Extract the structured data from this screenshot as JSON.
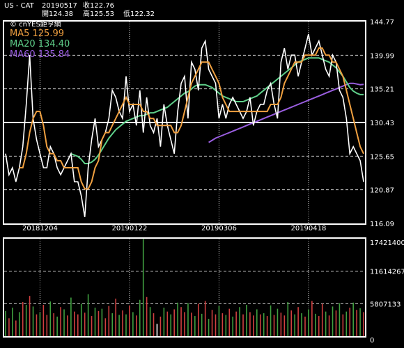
{
  "header": {
    "symbol": "US - CAT",
    "date": "20190517",
    "close_label": "收122.76",
    "open_label": "開124.38",
    "high_label": "高125.53",
    "low_label": "低122.32"
  },
  "legend": {
    "copyright": "© cnYES鉅亨網",
    "ma5": "MA5 125.99",
    "ma20": "MA20 134.40",
    "ma60": "MA60 135.84"
  },
  "colors": {
    "background": "#000000",
    "price": "#ffffff",
    "ma5": "#f0a040",
    "ma20": "#5fd08a",
    "ma60": "#9a5ee0",
    "vol_up": "#d04040",
    "vol_down": "#40a040",
    "grid": "#ffffff"
  },
  "chart_data": [
    {
      "type": "line",
      "title": "",
      "x_ticks": [
        "20181204",
        "20190122",
        "20190306",
        "20190418"
      ],
      "y_ticks": [
        "144.77",
        "139.99",
        "135.21",
        "130.43",
        "125.65",
        "120.87",
        "116.09"
      ],
      "ylim": [
        116.09,
        144.77
      ],
      "series": [
        {
          "name": "MA5",
          "key": "ma5"
        },
        {
          "name": "MA20",
          "key": "ma20"
        },
        {
          "name": "MA60",
          "key": "ma60"
        }
      ],
      "close": [
        126,
        123,
        124,
        122,
        124,
        127,
        133,
        140,
        131,
        128,
        126,
        124,
        124,
        127,
        126,
        124,
        123,
        124,
        125,
        126,
        122,
        122,
        120,
        117,
        124,
        128,
        131,
        127,
        128,
        129,
        131,
        135,
        134,
        132,
        131,
        137,
        132,
        133,
        130,
        135,
        129,
        134,
        130,
        129,
        131,
        127,
        133,
        130,
        128,
        126,
        132,
        136,
        137,
        131,
        139,
        138,
        135,
        141,
        142,
        138,
        137,
        136,
        131,
        133,
        131,
        133,
        134,
        133,
        132,
        131,
        132,
        134,
        130,
        132,
        133,
        133,
        135,
        136,
        133,
        131,
        139,
        141,
        138,
        140,
        140,
        137,
        139,
        141,
        143,
        140,
        141,
        142,
        140,
        138,
        137,
        140,
        139,
        135,
        134,
        131,
        126,
        127,
        126,
        125,
        122
      ],
      "ma5": [
        null,
        null,
        null,
        null,
        124,
        124,
        126,
        129,
        131,
        132,
        132,
        130,
        127,
        126,
        126,
        125,
        125,
        124,
        124,
        124,
        124,
        124,
        122,
        121,
        121,
        122,
        124,
        125,
        128,
        129,
        129,
        130,
        131,
        132,
        133,
        134,
        133,
        133,
        133,
        133,
        132,
        132,
        131,
        131,
        130,
        130,
        130,
        130,
        130,
        129,
        129,
        130,
        132,
        134,
        136,
        137,
        138,
        139,
        139,
        139,
        138,
        137,
        136,
        134,
        133,
        132,
        132,
        132,
        132,
        132,
        132,
        132,
        132,
        132,
        132,
        132,
        132,
        133,
        133,
        133,
        134,
        136,
        137,
        138,
        139,
        139,
        139,
        140,
        140,
        140,
        140,
        141,
        141,
        140,
        140,
        139,
        139,
        138,
        137,
        135,
        133,
        131,
        129,
        127,
        126
      ],
      "ma20": [
        null,
        null,
        null,
        null,
        null,
        null,
        null,
        null,
        null,
        null,
        null,
        null,
        null,
        null,
        null,
        null,
        null,
        null,
        null,
        126,
        125.8,
        125.6,
        125.2,
        124.6,
        124.6,
        124.8,
        125.2,
        125.8,
        126.6,
        127.4,
        128.2,
        128.8,
        129.4,
        129.8,
        130.2,
        130.6,
        130.8,
        131,
        131.2,
        131.4,
        131.4,
        131.6,
        131.8,
        131.8,
        132,
        132.2,
        132.4,
        132.6,
        133,
        133.4,
        133.8,
        134.2,
        134.6,
        134.8,
        135.2,
        135.6,
        135.8,
        135.8,
        135.8,
        135.6,
        135.4,
        135,
        134.6,
        134.2,
        134,
        133.8,
        133.6,
        133.4,
        133.4,
        133.4,
        133.6,
        133.8,
        134,
        134.2,
        134.6,
        135,
        135.4,
        135.8,
        136.2,
        136.6,
        137,
        137.4,
        137.8,
        138.2,
        138.6,
        139,
        139.2,
        139.4,
        139.6,
        139.6,
        139.6,
        139.6,
        139.4,
        139.2,
        139,
        138.6,
        138.2,
        137.6,
        137,
        136.2,
        135.4,
        134.9,
        134.6,
        134.4,
        134.4
      ],
      "ma60": [
        null,
        null,
        null,
        null,
        null,
        null,
        null,
        null,
        null,
        null,
        null,
        null,
        null,
        null,
        null,
        null,
        null,
        null,
        null,
        null,
        null,
        null,
        null,
        null,
        null,
        null,
        null,
        null,
        null,
        null,
        null,
        null,
        null,
        null,
        null,
        null,
        null,
        null,
        null,
        null,
        null,
        null,
        null,
        null,
        null,
        null,
        null,
        null,
        null,
        null,
        null,
        null,
        null,
        null,
        null,
        null,
        null,
        null,
        null,
        127.6,
        127.9,
        128.2,
        128.4,
        128.6,
        128.8,
        129,
        129.2,
        129.4,
        129.6,
        129.8,
        130,
        130.2,
        130.4,
        130.6,
        130.8,
        131,
        131.2,
        131.4,
        131.6,
        131.8,
        132,
        132.2,
        132.4,
        132.6,
        132.8,
        133,
        133.2,
        133.4,
        133.6,
        133.8,
        134,
        134.2,
        134.4,
        134.6,
        134.8,
        135,
        135.2,
        135.4,
        135.6,
        135.8,
        136,
        136,
        135.9,
        135.8,
        135.84
      ]
    },
    {
      "type": "bar",
      "title": "",
      "y_ticks": [
        "17421400",
        "11614267",
        "5807133",
        "0"
      ],
      "ylim": [
        0,
        17421400
      ],
      "volume": [
        4500000,
        3200000,
        5100000,
        2800000,
        4300000,
        6100000,
        5600000,
        7200000,
        5300000,
        3900000,
        4200000,
        5600000,
        3800000,
        6200000,
        4100000,
        3500000,
        5200000,
        4800000,
        3700000,
        6900000,
        4400000,
        3900000,
        5800000,
        4200000,
        7500000,
        3600000,
        5100000,
        4500000,
        4900000,
        3200000,
        5400000,
        4100000,
        6700000,
        3800000,
        4600000,
        3900000,
        5500000,
        4300000,
        3700000,
        6500000,
        17400000,
        7000000,
        5200000,
        4100000,
        2200000,
        3500000,
        5100000,
        4400000,
        3900000,
        4800000,
        6000000,
        5200000,
        4300000,
        5900000,
        4200000,
        3600000,
        5800000,
        4000000,
        6300000,
        3100000,
        4700000,
        3900000,
        5400000,
        4100000,
        3800000,
        4900000,
        3500000,
        4400000,
        5200000,
        3900000,
        5600000,
        4300000,
        3700000,
        4800000,
        3900000,
        4100000,
        3600000,
        5500000,
        3800000,
        4900000,
        4200000,
        3700000,
        6100000,
        4600000,
        3900000,
        5200000,
        4100000,
        3500000,
        4800000,
        6300000,
        4000000,
        3600000,
        5800000,
        4400000,
        3700000,
        5300000,
        4600000,
        5900000,
        3900000,
        4400000,
        5100000,
        6000000,
        4700000,
        5000000,
        4300000
      ],
      "volume_up": [
        0,
        1,
        0,
        1,
        0,
        1,
        0,
        1,
        0,
        1,
        0,
        1,
        1,
        0,
        1,
        0,
        1,
        0,
        1,
        0,
        1,
        1,
        0,
        1,
        0,
        1,
        0,
        1,
        0,
        1,
        1,
        0,
        1,
        0,
        1,
        0,
        1,
        0,
        1,
        0,
        0,
        1,
        0,
        1,
        2,
        1,
        0,
        1,
        0,
        1,
        0,
        1,
        1,
        0,
        1,
        0,
        1,
        0,
        1,
        0,
        1,
        1,
        0,
        1,
        0,
        1,
        0,
        1,
        0,
        1,
        0,
        1,
        1,
        0,
        1,
        0,
        1,
        0,
        1,
        0,
        1,
        1,
        0,
        1,
        0,
        1,
        0,
        1,
        0,
        1,
        0,
        1,
        1,
        0,
        1,
        0,
        1,
        0,
        1,
        0,
        1,
        0,
        1,
        0,
        1
      ]
    }
  ]
}
